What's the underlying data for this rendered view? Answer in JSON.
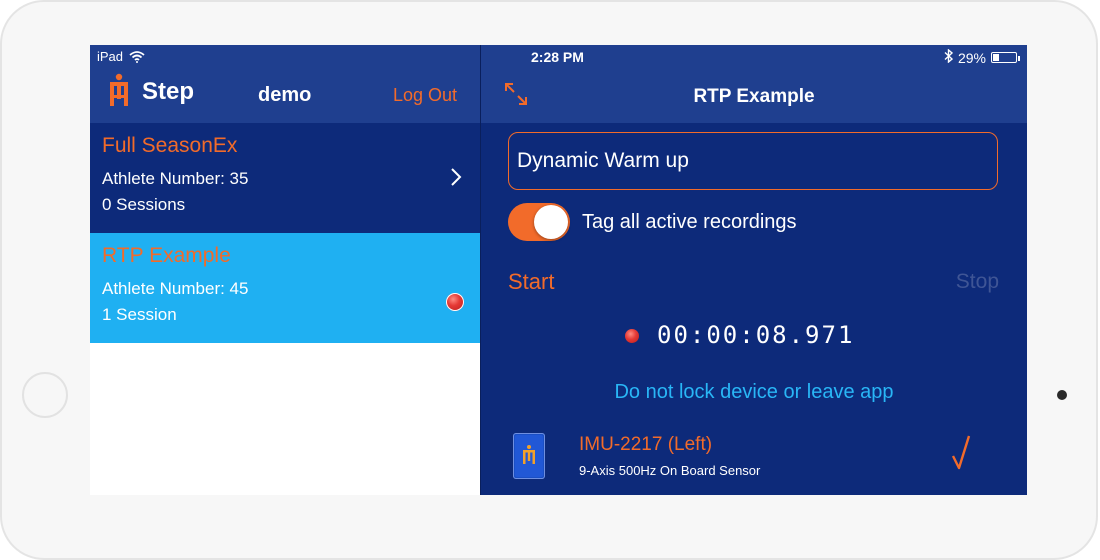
{
  "status_bar": {
    "device": "iPad",
    "time": "2:28 PM",
    "battery_percent": "29%",
    "battery_level": 0.29
  },
  "sidebar": {
    "app_name": "Step",
    "username": "demo",
    "logout_label": "Log Out",
    "teams": [
      {
        "name": "Full SeasonEx",
        "athletes": "Athlete Number: 35",
        "sessions": "0 Sessions"
      },
      {
        "name": "RTP Example",
        "athletes": "Athlete Number: 45",
        "sessions": "1 Session"
      }
    ]
  },
  "main": {
    "title": "RTP Example",
    "tag_value": "Dynamic Warm up",
    "toggle_label": "Tag all active recordings",
    "toggle_on": true,
    "start_label": "Start",
    "stop_label": "Stop",
    "timer": "00:00:08.971",
    "warning": "Do not lock device or leave app",
    "sensor": {
      "name": "IMU-2217 (Left)",
      "description": "9-Axis 500Hz On Board Sensor"
    }
  },
  "colors": {
    "accent": "#f26b2a",
    "navy": "#0d2a7a",
    "header": "#1f3f8f",
    "selected_row": "#1fb0f2",
    "link": "#29b6f6"
  },
  "icons": [
    "wifi-icon",
    "bluetooth-icon",
    "battery-icon",
    "step-logo-icon",
    "chevron-right-icon",
    "recording-icon",
    "expand-icon",
    "sensor-icon",
    "signal-check-icon"
  ]
}
